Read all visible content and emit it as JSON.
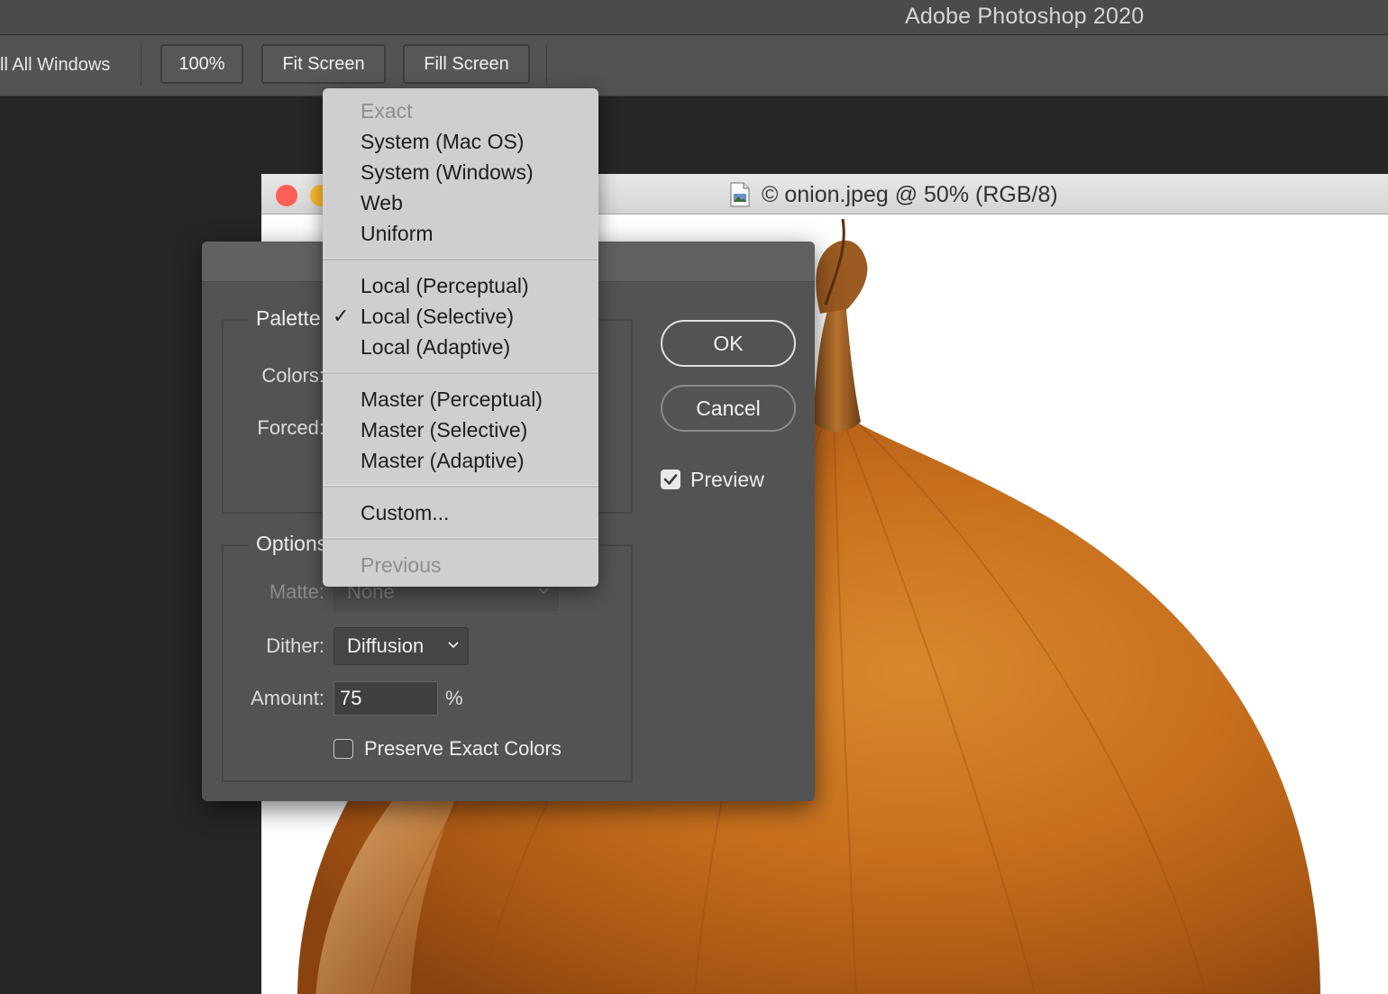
{
  "app": {
    "title": "Adobe Photoshop 2020"
  },
  "options_bar": {
    "all_windows_text": "ll All Windows",
    "zoom_100_label": "100%",
    "fit_screen_label": "Fit Screen",
    "fill_screen_label": "Fill Screen"
  },
  "document": {
    "title": "© onion.jpeg @ 50% (RGB/8)"
  },
  "dialog": {
    "palette_group_label": "Palette",
    "colors_label": "Colors:",
    "forced_label": "Forced:",
    "options_group_label": "Options",
    "matte_label": "Matte:",
    "matte_value": "None",
    "dither_label": "Dither:",
    "dither_value": "Diffusion",
    "amount_label": "Amount:",
    "amount_value": "75",
    "amount_unit": "%",
    "preserve_label": "Preserve Exact Colors",
    "preserve_checked": false,
    "ok_label": "OK",
    "cancel_label": "Cancel",
    "preview_label": "Preview",
    "preview_checked": true
  },
  "palette_menu": {
    "items": [
      {
        "label": "Exact",
        "disabled": true
      },
      {
        "label": "System (Mac OS)"
      },
      {
        "label": "System (Windows)"
      },
      {
        "label": "Web"
      },
      {
        "label": "Uniform"
      },
      {
        "label": "Local (Perceptual)"
      },
      {
        "label": "Local (Selective)",
        "checked": true
      },
      {
        "label": "Local (Adaptive)"
      },
      {
        "label": "Master (Perceptual)"
      },
      {
        "label": "Master (Selective)"
      },
      {
        "label": "Master (Adaptive)"
      },
      {
        "label": "Custom..."
      },
      {
        "label": "Previous",
        "disabled": true
      }
    ],
    "check_mark": "✓"
  },
  "colors": {
    "close_button": "#fe5f57",
    "minimize_button": "#febc2e",
    "checkbox_checked": "#e8e8e8"
  }
}
